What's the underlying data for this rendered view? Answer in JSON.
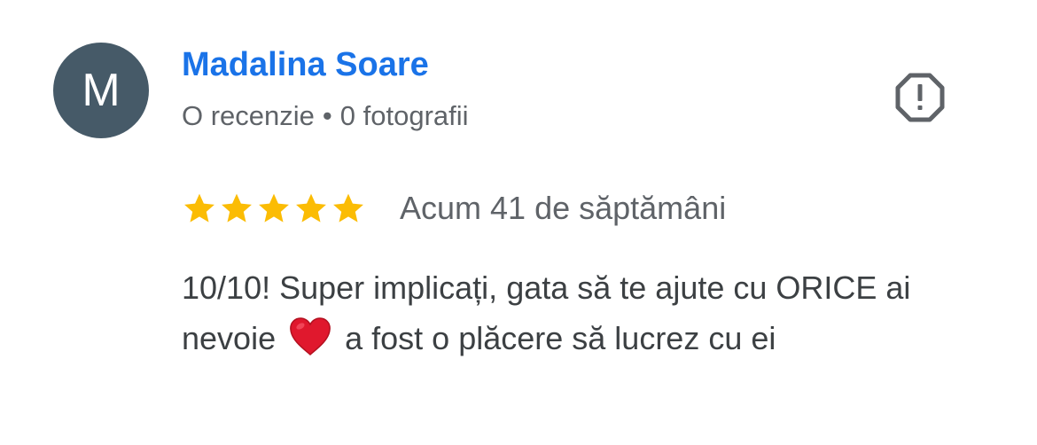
{
  "reviewer": {
    "avatar_letter": "M",
    "avatar_color": "#465a68",
    "name": "Madalina Soare",
    "name_color": "#1a73e8",
    "review_count": "O recenzie",
    "separator": "•",
    "photo_count": "0 fotografii"
  },
  "report": {
    "icon": "report-octagon-icon"
  },
  "review": {
    "rating": 5,
    "max_rating": 5,
    "star_color": "#fbbc04",
    "date": "Acum 41 de săptămâni",
    "text_before_emoji": "10/10! Super implicați, gata să te ajute cu ORICE ai nevoie",
    "emoji": "heart-icon",
    "text_after_emoji": "a fost o plăcere să lucrez cu ei"
  }
}
